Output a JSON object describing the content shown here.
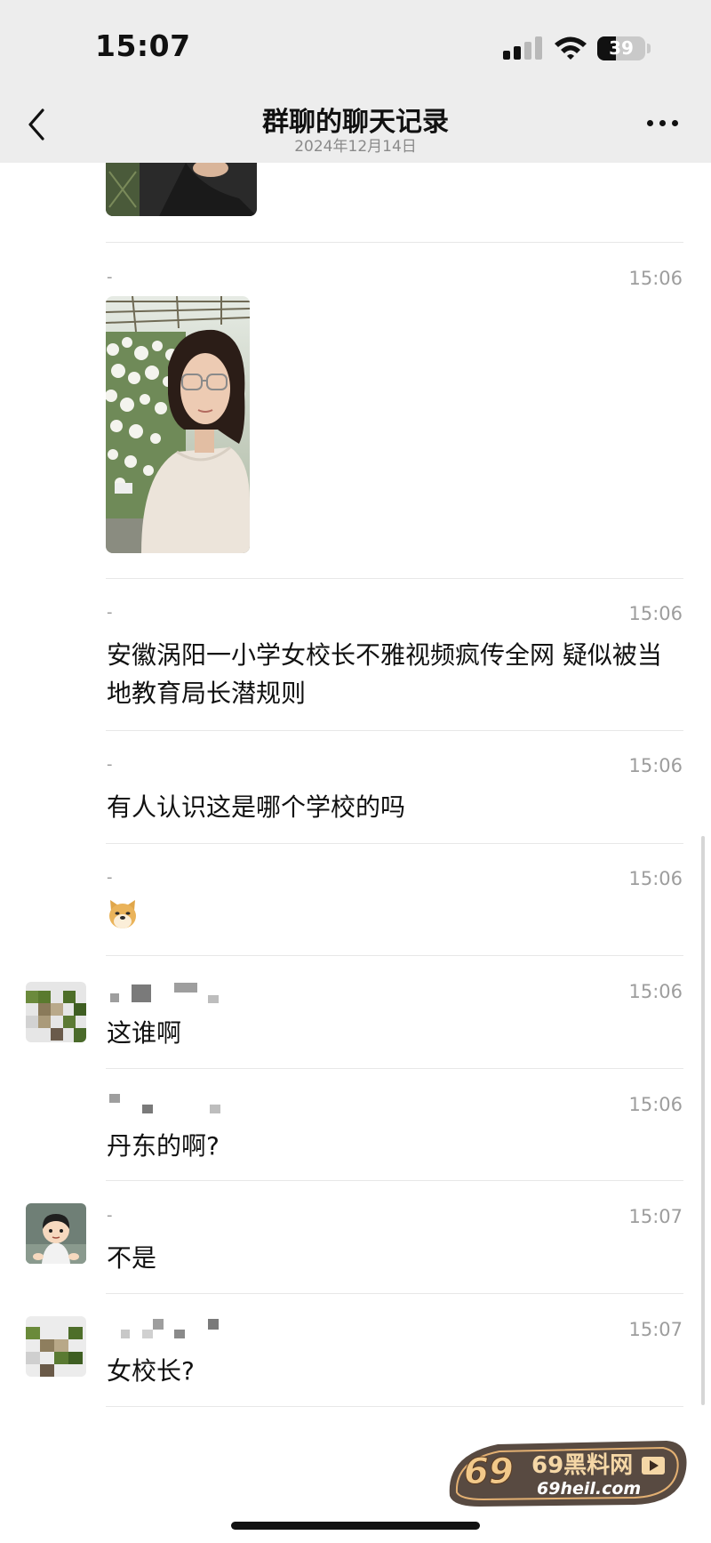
{
  "status_bar": {
    "time": "15:07",
    "battery_percent": "39",
    "battery_level": 0.39,
    "icons": [
      "cellular-signal-icon",
      "wifi-icon",
      "battery-icon"
    ]
  },
  "nav": {
    "back_icon": "chevron-left-icon",
    "title": "群聊的聊天记录",
    "subtitle": "2024年12月14日",
    "more_icon": "ellipsis-icon"
  },
  "messages": [
    {
      "sender": "-",
      "time": "15:06",
      "type": "image",
      "image_desc": "selfie-photo"
    },
    {
      "sender": "-",
      "time": "15:06",
      "type": "text",
      "text": "安徽涡阳一小学女校长不雅视频疯传全网 疑似被当地教育局长潜规则"
    },
    {
      "sender": "-",
      "time": "15:06",
      "type": "text",
      "text": "有人认识这是哪个学校的吗"
    },
    {
      "sender": "-",
      "time": "15:06",
      "type": "sticker",
      "sticker": "doge-sticker"
    },
    {
      "sender": "",
      "time": "15:06",
      "type": "text",
      "text": "这谁啊",
      "avatar": "pixelated-avatar"
    },
    {
      "sender": "",
      "time": "15:06",
      "type": "text",
      "text": "丹东的啊?"
    },
    {
      "sender": "-",
      "time": "15:07",
      "type": "text",
      "text": "不是",
      "avatar": "cartoon-boy-avatar"
    },
    {
      "sender": "",
      "time": "15:07",
      "type": "text",
      "text": "女校长?",
      "avatar": "pixelated-avatar"
    }
  ],
  "watermark": {
    "brand": "69黑料网",
    "url": "69heil.com"
  },
  "colors": {
    "header_bg": "#ededed",
    "page_bg": "#ffffff",
    "separator": "#e7e7e7",
    "meta_text": "#9d9d9d",
    "body_text": "#111111"
  }
}
